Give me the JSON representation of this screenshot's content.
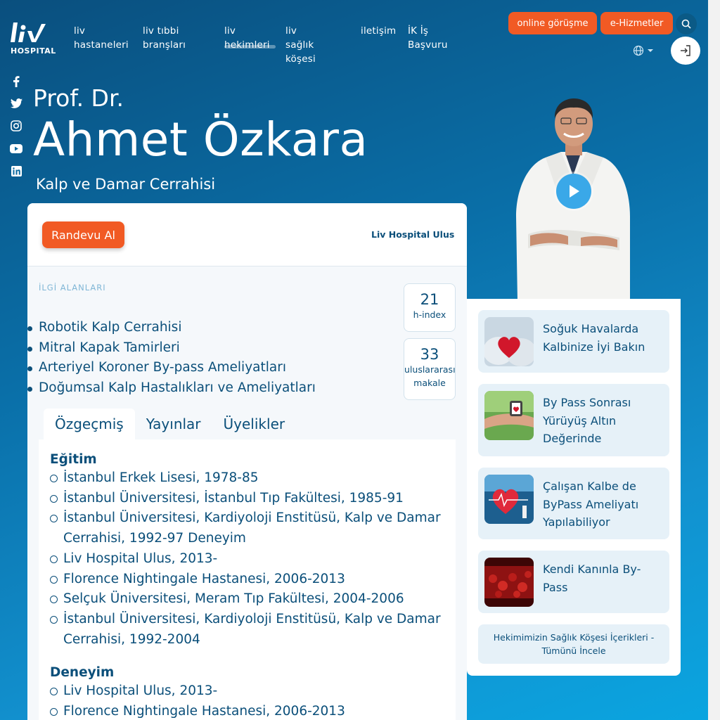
{
  "brand": {
    "logo_text": "HOSPITAL"
  },
  "nav": {
    "items": [
      {
        "line1": "liv",
        "line2": "hastaneleri"
      },
      {
        "line1": "liv tıbbi",
        "line2": "branşları"
      },
      {
        "line1": "liv",
        "line2": "hekimleri"
      },
      {
        "line1": "liv sağlık",
        "line2": "köşesi"
      },
      {
        "line1": "iletişim",
        "line2": ""
      },
      {
        "line1": "İK İş",
        "line2": "Başvuru"
      }
    ],
    "online_label": "online görüşme",
    "ehizmet_label": "e-Hizmetler"
  },
  "social": [
    "facebook-icon",
    "twitter-icon",
    "instagram-icon",
    "youtube-icon",
    "linkedin-icon"
  ],
  "doctor": {
    "title": "Prof. Dr.",
    "name": "Ahmet Özkara",
    "specialty": "Kalp ve Damar Cerrahisi"
  },
  "card": {
    "appointment_label": "Randevu Al",
    "hospital": "Liv Hospital Ulus",
    "interests_title": "İLGİ ALANLARI",
    "interests": [
      "Robotik Kalp Cerrahisi",
      "Mitral Kapak Tamirleri",
      "Arteriyel Koroner By-pass Ameliyatları",
      "Doğumsal Kalp Hastalıkları ve Ameliyatları"
    ],
    "stats": [
      {
        "value": "21",
        "label_line1": "h-index",
        "label_line2": ""
      },
      {
        "value": "33",
        "label_line1": "uluslararası",
        "label_line2": "makale"
      }
    ],
    "tabs": [
      "Özgeçmiş",
      "Yayınlar",
      "Üyelikler"
    ],
    "education_title": "Eğitim",
    "education": [
      "İstanbul Erkek Lisesi, 1978-85",
      "İstanbul Üniversitesi, İstanbul Tıp Fakültesi, 1985-91",
      "İstanbul Üniversitesi, Kardiyoloji Enstitüsü, Kalp ve Damar Cerrahisi, 1992-97 Deneyim",
      "Liv Hospital Ulus, 2013-",
      "Florence Nightingale Hastanesi, 2006-2013",
      "Selçuk Üniversitesi, Meram Tıp Fakültesi, 2004-2006",
      "İstanbul Üniversitesi, Kardiyoloji Enstitüsü, Kalp ve Damar Cerrahisi, 1992-2004"
    ],
    "experience_title": "Deneyim",
    "experience": [
      "Liv Hospital Ulus, 2013-",
      "Florence Nightingale Hastanesi, 2006-2013"
    ]
  },
  "posts": [
    {
      "title": "Soğuk Havalarda Kalbinize İyi Bakın"
    },
    {
      "title": "By Pass Sonrası Yürüyüş Altın Değerinde"
    },
    {
      "title": "Çalışan Kalbe de ByPass Ameliyatı Yapılabiliyor"
    },
    {
      "title": "Kendi Kanınla By-Pass"
    }
  ],
  "posts_all_label": "Hekimimizin Sağlık Köşesi İçerikleri - Tümünü İncele",
  "colors": {
    "accent": "#f15a24",
    "primary": "#0b4f7a",
    "background": "#0a6fa8"
  }
}
